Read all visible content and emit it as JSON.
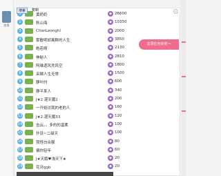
{
  "app": {
    "label": "应用"
  },
  "menu": {
    "search": "搜索",
    "copy": "复制"
  },
  "promo": {
    "label": "去领任务的奖～"
  },
  "rows": [
    {
      "rank": "1",
      "level": "",
      "name": "黄奶奶",
      "score": "26600"
    },
    {
      "rank": "2",
      "level": "",
      "name": "秋山海",
      "score": "10350"
    },
    {
      "rank": "3",
      "level": "",
      "name": "ChanLeonghl",
      "score": "2000"
    },
    {
      "rank": "4",
      "level": "",
      "name": "雾散明却离群的人生",
      "score": "3850"
    },
    {
      "rank": "5",
      "level": "",
      "name": "皓若晴",
      "score": "2130"
    },
    {
      "rank": "6",
      "level": "",
      "name": "神秘人",
      "score": "2810"
    },
    {
      "rank": "7",
      "level": "",
      "name": "阿维遗风秃风空",
      "score": "1800"
    },
    {
      "rank": "8",
      "level": "",
      "name": "采撷人生无常",
      "score": "1500"
    },
    {
      "rank": "9",
      "level": "",
      "name": "静叶时",
      "score": "600"
    },
    {
      "rank": "10",
      "level": "",
      "name": "静平某人",
      "score": "340"
    },
    {
      "rank": "11",
      "level": "",
      "name": "J★2.湛天魔1",
      "score": "200"
    },
    {
      "rank": "12",
      "level": "",
      "name": "一开始访我的老的人",
      "score": "160"
    },
    {
      "rank": "13",
      "level": "",
      "name": "J★2.湛天魔33",
      "score": "120"
    },
    {
      "rank": "14",
      "level": "",
      "name": "吉云。。多的的温柔",
      "score": "100"
    },
    {
      "rank": "15",
      "level": "",
      "name": "扑设✧二级天",
      "score": "100"
    },
    {
      "rank": "16",
      "level": "",
      "name": "我怪白合额",
      "score": "80"
    },
    {
      "rank": "17",
      "level": "",
      "name": "偏你轻年",
      "score": "60"
    },
    {
      "rank": "18",
      "level": "",
      "name": "J★天鹅♥浅天下★",
      "score": "20"
    },
    {
      "rank": "19",
      "level": "",
      "name": "花牙ggb",
      "score": "20"
    }
  ]
}
